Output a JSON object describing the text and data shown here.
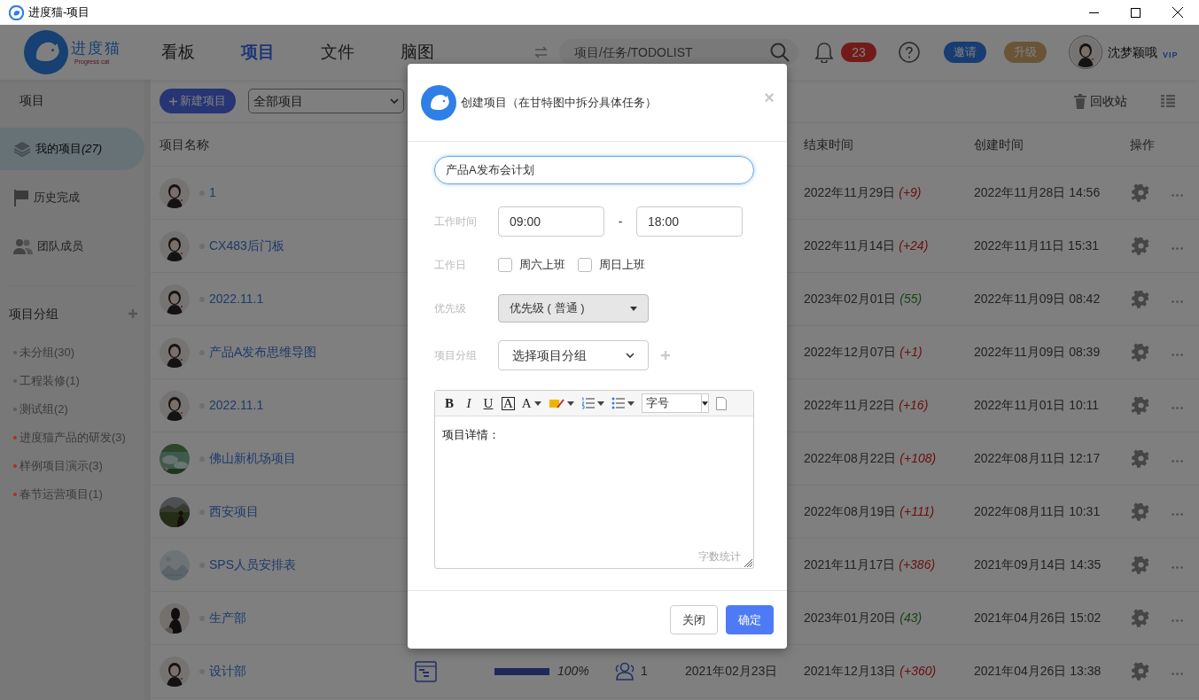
{
  "window": {
    "title": "进度猫-项目"
  },
  "header": {
    "logo": {
      "name": "进度猫",
      "tagline": "Progress cat"
    },
    "nav": [
      {
        "label": "看板",
        "selected": false
      },
      {
        "label": "项目",
        "selected": true
      },
      {
        "label": "文件",
        "selected": false
      },
      {
        "label": "脑图",
        "selected": false
      }
    ],
    "search": {
      "placeholder": "项目/任务/TODOLIST"
    },
    "notifications": "23",
    "invite": "邀请",
    "upgrade": "升级",
    "user": {
      "name": "沈梦颖哦",
      "badge": "VIP"
    }
  },
  "sidebar": {
    "title": "项目",
    "items": [
      {
        "label": "我的项目",
        "count": "(27)",
        "kind": "stack",
        "selected": true
      },
      {
        "label": "历史完成",
        "kind": "flag",
        "selected": false
      },
      {
        "label": "团队成员",
        "kind": "team",
        "selected": false
      }
    ],
    "groups_title": "项目分组",
    "groups": [
      {
        "label": "未分组(30)",
        "color": "#5a5a5a"
      },
      {
        "label": "工程装修(1)",
        "color": "#5a5a5a"
      },
      {
        "label": "测试组(2)",
        "color": "#5a5a5a"
      },
      {
        "label": "进度猫产品的研发(3)",
        "color": "#b0301a"
      },
      {
        "label": "样例项目演示(3)",
        "color": "#b0301a"
      },
      {
        "label": "春节运营项目(1)",
        "color": "#b0301a"
      }
    ]
  },
  "toolbar": {
    "new_button": "新建项目",
    "filter": "全部项目",
    "recycle": "回收站"
  },
  "table": {
    "columns": {
      "name": "项目名称",
      "end": "结束时间",
      "created": "创建时间",
      "actions": "操作"
    },
    "rows": [
      {
        "name": "1",
        "end": "2022年11月29日",
        "delta": "(+9)",
        "overdue": true,
        "created": "2022年11月28日 14:56"
      },
      {
        "name": "CX483后门板",
        "end": "2022年11月14日",
        "delta": "(+24)",
        "overdue": true,
        "created": "2022年11月11日 15:31"
      },
      {
        "name": "2022.11.1",
        "end": "2023年02月01日",
        "delta": "(55)",
        "overdue": false,
        "created": "2022年11月09日 08:42"
      },
      {
        "name": "产品A发布思维导图",
        "end": "2022年12月07日",
        "delta": "(+1)",
        "overdue": true,
        "created": "2022年11月09日 08:39"
      },
      {
        "name": "2022.11.1",
        "end": "2022年11月22日",
        "delta": "(+16)",
        "overdue": true,
        "created": "2022年11月01日 10:11"
      },
      {
        "name": "佛山新机场项目",
        "end": "2022年08月22日",
        "delta": "(+108)",
        "overdue": true,
        "created": "2022年08月11日 12:17"
      },
      {
        "name": "西安项目",
        "end": "2022年08月19日",
        "delta": "(+111)",
        "overdue": true,
        "created": "2022年08月11日 10:31"
      },
      {
        "name": "SPS人员安排表",
        "end": "2021年11月17日",
        "delta": "(+386)",
        "overdue": true,
        "created": "2021年09月14日 14:35"
      },
      {
        "name": "生产部",
        "end": "2023年01月20日",
        "delta": "(43)",
        "overdue": false,
        "created": "2021年04月26日 15:02"
      },
      {
        "name": "设计部",
        "level": 1,
        "progress": "100%",
        "members": "1",
        "start": "2021年02月23日",
        "end": "2021年12月13日",
        "delta": "(+360)",
        "overdue": true,
        "created": "2021年04月26日 13:38"
      }
    ]
  },
  "dialog": {
    "title": "创建项目（在甘特图中拆分具体任务）",
    "close": "×",
    "name_value": "产品A发布会计划",
    "work_time": {
      "label": "工作时间",
      "start": "09:00",
      "separator": "-",
      "end": "18:00"
    },
    "workdays": {
      "label": "工作日",
      "options": [
        {
          "label": "周六上班",
          "checked": false
        },
        {
          "label": "周日上班",
          "checked": false
        }
      ]
    },
    "priority": {
      "label": "优先级",
      "value": "优先级 ( 普通 )"
    },
    "group": {
      "label": "项目分组",
      "value": "选择项目分组"
    },
    "editor": {
      "tools": [
        {
          "kind": "bold",
          "label": "B"
        },
        {
          "kind": "italic",
          "label": "I"
        },
        {
          "kind": "underline",
          "label": "U"
        },
        {
          "kind": "boxed",
          "label": "A"
        },
        {
          "kind": "font-color",
          "label": "A"
        },
        {
          "kind": "highlight"
        },
        {
          "kind": "ordered-list"
        },
        {
          "kind": "bullet-list"
        }
      ],
      "font_size": "字号",
      "content": "项目详情：",
      "word_count": "字数统计"
    },
    "buttons": [
      {
        "label": "关闭",
        "kind": "secondary"
      },
      {
        "label": "确定",
        "kind": "primary"
      }
    ]
  }
}
